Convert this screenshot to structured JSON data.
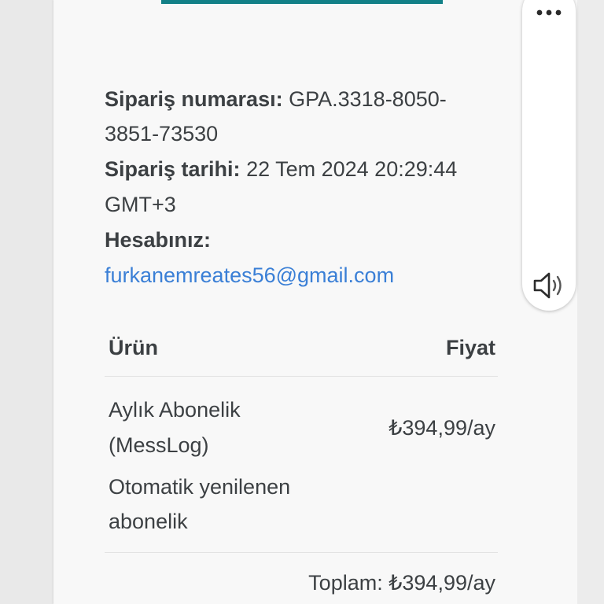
{
  "order": {
    "number_label": "Sipariş numarası:",
    "number_value_line1": "GPA.3318-8050-",
    "number_value_line2": "3851-73530",
    "date_label": "Sipariş tarihi:",
    "date_value_line1": "22 Tem 2024 20:29:44",
    "date_value_line2": "GMT+3",
    "account_label": "Hesabınız:",
    "account_email": "furkanemreates56@gmail.com"
  },
  "table": {
    "col_product": "Ürün",
    "col_price": "Fiyat",
    "rows": [
      {
        "name_line1": "Aylık Abonelik",
        "name_line2": "(MessLog)",
        "note_line1": "Otomatik yenilenen",
        "note_line2": "abonelik",
        "price": "₺394,99/ay"
      }
    ],
    "total": "Toplam: ₺394,99/ay"
  },
  "icons": {
    "more": "more-horizontal-icon",
    "speaker": "speaker-icon"
  },
  "colors": {
    "accent_bar": "#128087",
    "link": "#3a7fd6",
    "text": "#3c4043"
  }
}
